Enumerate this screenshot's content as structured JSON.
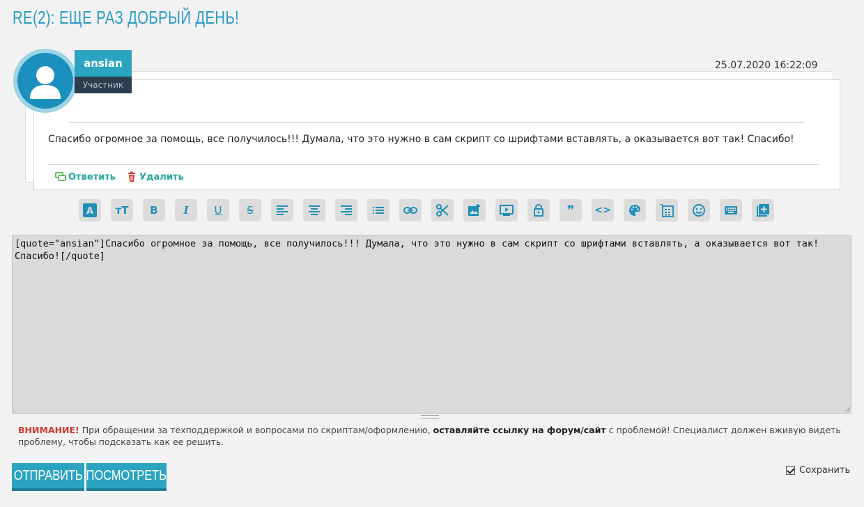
{
  "page": {
    "title": "RE(2): ЕЩЕ РАЗ ДОБРЫЙ ДЕНЬ!"
  },
  "post": {
    "author": "ansian",
    "role": "Участник",
    "date": "25.07.2020 16:22:09",
    "text": "Спасибо огромное за помощь, все получилось!!! Думала, что это нужно в сам скрипт со шрифтами вставлять, а оказывается вот так! Спасибо!",
    "reply_label": "Ответить",
    "delete_label": "Удалить"
  },
  "toolbar": {
    "buttons": [
      {
        "icon": "font-color-icon"
      },
      {
        "icon": "font-size-icon",
        "glyph": "тТ"
      },
      {
        "icon": "bold-icon",
        "glyph": "B"
      },
      {
        "icon": "italic-icon",
        "glyph": "I"
      },
      {
        "icon": "underline-icon",
        "glyph": "U"
      },
      {
        "icon": "strikethrough-icon",
        "glyph": "S"
      },
      {
        "icon": "align-left-icon"
      },
      {
        "icon": "align-center-icon"
      },
      {
        "icon": "align-right-icon"
      },
      {
        "icon": "list-icon"
      },
      {
        "icon": "link-icon"
      },
      {
        "icon": "cut-icon"
      },
      {
        "icon": "image-icon"
      },
      {
        "icon": "video-icon"
      },
      {
        "icon": "lock-icon"
      },
      {
        "icon": "quote-icon",
        "glyph": "❞"
      },
      {
        "icon": "code-icon",
        "glyph": "<>"
      },
      {
        "icon": "palette-icon"
      },
      {
        "icon": "table-icon"
      },
      {
        "icon": "smiley-icon"
      },
      {
        "icon": "keyboard-icon"
      },
      {
        "icon": "add-box-icon"
      }
    ]
  },
  "editor": {
    "value": "[quote=\"ansian\"]Спасибо огромное за помощь, все получилось!!! Думала, что это нужно в сам скрипт со шрифтами вставлять, а оказывается вот так! Спасибо![/quote]"
  },
  "notice": {
    "warning": "ВНИМАНИЕ!",
    "part1": " При обращении за техподдержкой и вопросами по скриптам/оформлению, ",
    "bold": "оставляйте ссылку на форум/сайт",
    "part2": " с проблемой! Специалист должен вживую видеть проблему, чтобы подсказать как ее решить."
  },
  "actions": {
    "submit": "ОТПРАВИТЬ",
    "preview": "ПОСМОТРЕТЬ",
    "save": "Сохранить"
  },
  "colors": {
    "accent": "#2aa4c0",
    "title": "#2a9cc6",
    "warning": "#d03b2f"
  }
}
